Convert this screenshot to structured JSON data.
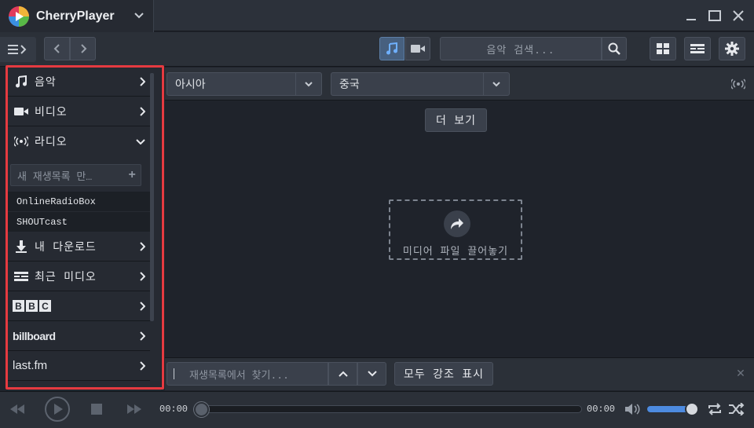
{
  "app": {
    "name": "CherryPlayer"
  },
  "toolbar": {
    "search_placeholder": "음악 검색..."
  },
  "sidebar": {
    "items": [
      {
        "label": "음악",
        "icon": "music-note-icon"
      },
      {
        "label": "비디오",
        "icon": "video-camera-icon"
      },
      {
        "label": "라디오",
        "icon": "radio-broadcast-icon"
      },
      {
        "label": "내 다운로드",
        "icon": "download-icon"
      },
      {
        "label": "최근 미디오",
        "icon": "recent-media-icon"
      },
      {
        "label": "BBC",
        "icon": "bbc-logo"
      },
      {
        "label": "billboard",
        "icon": "billboard-logo"
      },
      {
        "label": "last.fm",
        "icon": "lastfm-logo"
      }
    ],
    "new_playlist_placeholder": "새 재생목록 만…",
    "radio_playlists": [
      "OnlineRadioBox",
      "SHOUTcast"
    ]
  },
  "filters": {
    "region": "아시아",
    "country": "중국"
  },
  "content": {
    "more_label": "더 보기",
    "drop_hint": "미디어 파일 끌어놓기"
  },
  "playlist_bar": {
    "search_placeholder": "재생목록에서 찾기...",
    "highlight_all_label": "모두 강조 표시"
  },
  "player": {
    "elapsed": "00:00",
    "duration": "00:00",
    "volume_level": 0.85
  },
  "colors": {
    "accent": "#4d8be0",
    "highlight_border": "#e53a40",
    "background": "#1f232b"
  }
}
